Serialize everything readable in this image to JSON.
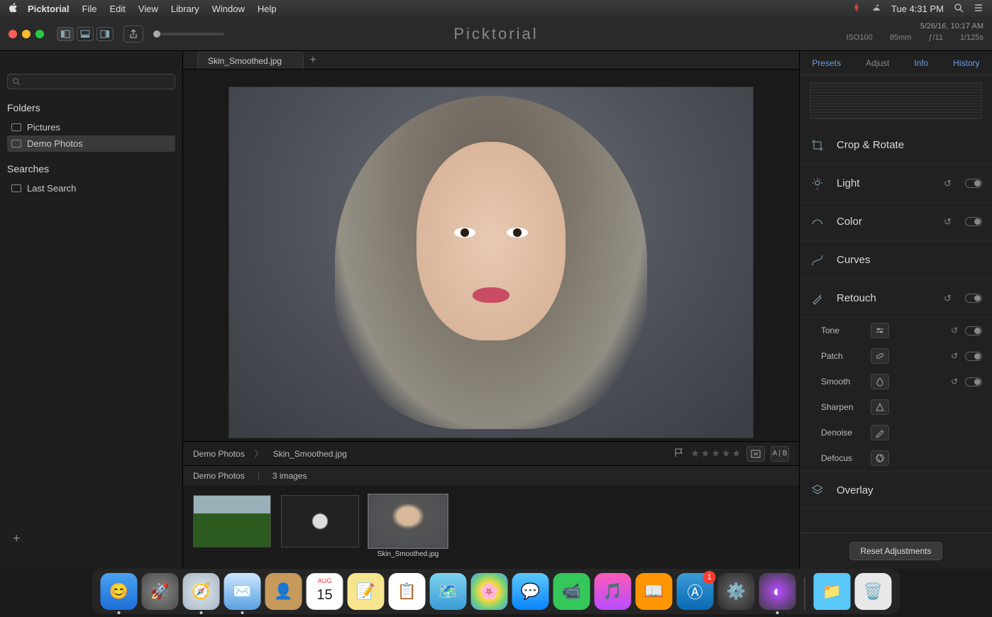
{
  "menubar": {
    "app": "Picktorial",
    "items": [
      "File",
      "Edit",
      "View",
      "Library",
      "Window",
      "Help"
    ],
    "clock": "Tue 4:31 PM"
  },
  "toolbar": {
    "title": "Picktorial",
    "datetime": "5/26/16, 10:17 AM",
    "iso": "ISO100",
    "focal": "85mm",
    "aperture": "ƒ/11",
    "shutter": "1/125s"
  },
  "tab": {
    "name": "Skin_Smoothed.jpg"
  },
  "sidebar": {
    "folders_label": "Folders",
    "folders": [
      "Pictures",
      "Demo Photos"
    ],
    "searches_label": "Searches",
    "searches": [
      "Last Search"
    ]
  },
  "pathbar": {
    "crumb1": "Demo Photos",
    "crumb2": "Skin_Smoothed.jpg",
    "ab": "A | B"
  },
  "filmstrip": {
    "folder": "Demo Photos",
    "count": "3 images",
    "sel_name": "Skin_Smoothed.jpg"
  },
  "rightpanel": {
    "tabs": [
      "Presets",
      "Adjust",
      "Info",
      "History"
    ],
    "adjustments": {
      "crop": "Crop & Rotate",
      "light": "Light",
      "color": "Color",
      "curves": "Curves",
      "retouch": "Retouch",
      "overlay": "Overlay"
    },
    "retouch_sub": [
      "Tone",
      "Patch",
      "Smooth",
      "Sharpen",
      "Denoise",
      "Defocus"
    ],
    "reset": "Reset Adjustments"
  },
  "dock": {
    "appstore_badge": "1"
  }
}
